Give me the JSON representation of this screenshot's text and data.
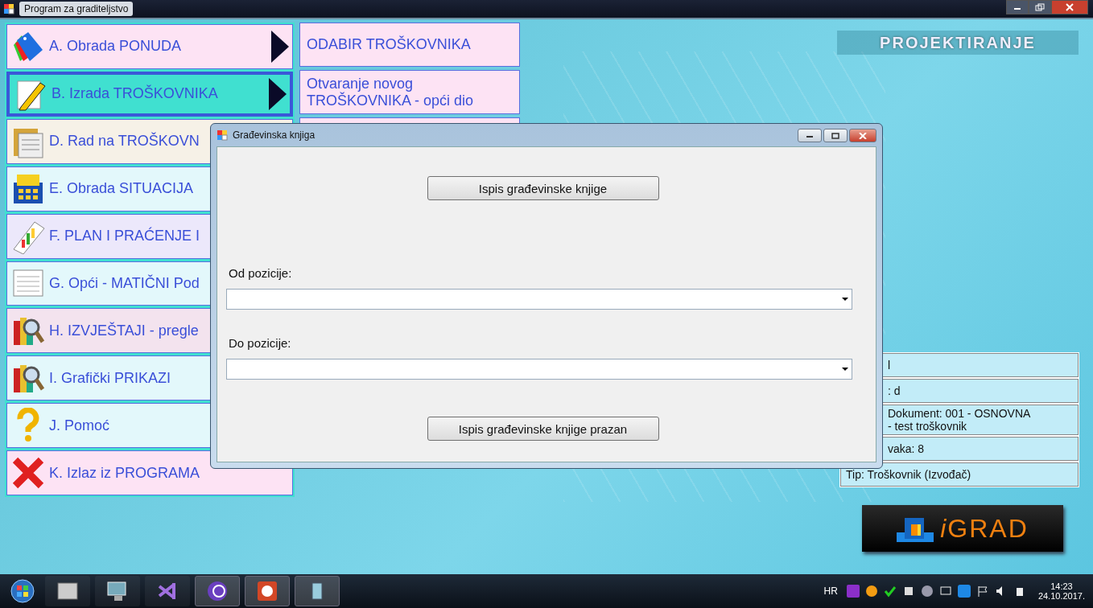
{
  "window": {
    "title": "Program za graditeljstvo"
  },
  "header": {
    "title": "PROJEKTIRANJE"
  },
  "menu": [
    {
      "kind": "tags",
      "label": "A. Obrada PONUDA",
      "selected": false,
      "arrow": true,
      "color": "#fde3f4"
    },
    {
      "kind": "pencil",
      "label": "B. Izrada TROŠKOVNIKA",
      "selected": true,
      "arrow": true,
      "color": "#40e0d0"
    },
    {
      "kind": "folder",
      "label": "D. Rad na TROŠKOVN",
      "selected": false,
      "arrow": false,
      "color": "#f6f1e7"
    },
    {
      "kind": "calculator",
      "label": "E. Obrada SITUACIJA",
      "selected": false,
      "arrow": false,
      "color": "#e3f8fb"
    },
    {
      "kind": "chart",
      "label": "F. PLAN I PRAĆENJE I",
      "selected": false,
      "arrow": false,
      "color": "#ece8fb"
    },
    {
      "kind": "list",
      "label": "G. Opći - MATIČNI Pod",
      "selected": false,
      "arrow": false,
      "color": "#e3f8fb"
    },
    {
      "kind": "magnifier",
      "label": "H. IZVJEŠTAJI - pregle",
      "selected": false,
      "arrow": false,
      "color": "#f3e3ee"
    },
    {
      "kind": "magnifier",
      "label": "I. Grafički PRIKAZI",
      "selected": false,
      "arrow": false,
      "color": "#e3f8fb"
    },
    {
      "kind": "question",
      "label": "J. Pomoć",
      "selected": false,
      "arrow": false,
      "color": "#e3f8fb"
    },
    {
      "kind": "cross",
      "label": "K. Izlaz iz PROGRAMA",
      "selected": false,
      "arrow": false,
      "color": "#fde3f4"
    }
  ],
  "submenu": [
    "ODABIR TROŠKOVNIKA",
    "Otvaranje novog TROŠKOVNIKA - opći dio"
  ],
  "info": [
    {
      "lines": [
        "l"
      ]
    },
    {
      "lines": [
        ": d"
      ]
    },
    {
      "lines": [
        "Dokument: 001 - OSNOVNA",
        "- test troškovnik"
      ]
    },
    {
      "lines": [
        "vaka: 8"
      ]
    },
    {
      "lines": [
        "Tip: Troškovnik (Izvođač)"
      ]
    }
  ],
  "logo": {
    "text": "GRAD",
    "prefix": "i"
  },
  "dialog": {
    "title": "Građevinska knjiga",
    "button_top": "Ispis građevinske knjige",
    "from_label": "Od pozicije:",
    "to_label": "Do pozicije:",
    "button_bottom": "Ispis građevinske knjige prazan"
  },
  "taskbar": {
    "language": "HR",
    "time": "14:23",
    "date": "24.10.2017."
  }
}
